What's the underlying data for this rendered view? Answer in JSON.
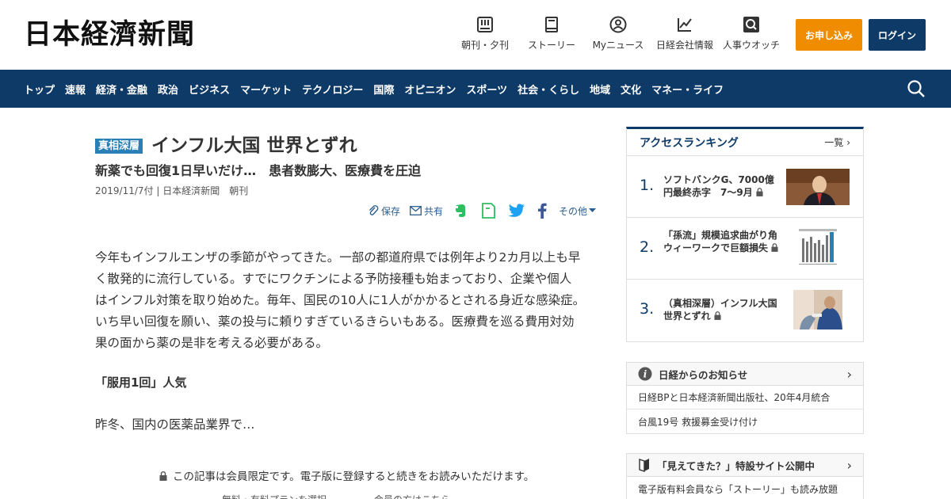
{
  "header": {
    "logo": "日本経濟新聞",
    "nav": [
      {
        "label": "朝刊・夕刊",
        "icon": "newspaper-icon"
      },
      {
        "label": "ストーリー",
        "icon": "book-icon"
      },
      {
        "label": "Myニュース",
        "icon": "user-icon"
      },
      {
        "label": "日経会社情報",
        "icon": "chart-icon"
      },
      {
        "label": "人事ウオッチ",
        "icon": "search-person-icon"
      }
    ],
    "apply_label": "お申し込み",
    "login_label": "ログイン"
  },
  "main_nav": [
    "トップ",
    "速報",
    "経済・金融",
    "政治",
    "ビジネス",
    "マーケット",
    "テクノロジー",
    "国際",
    "オピニオン",
    "スポーツ",
    "社会・くらし",
    "地域",
    "文化",
    "マネー・ライフ"
  ],
  "article": {
    "tag": "真相深層",
    "title": "インフル大国 世界とずれ",
    "subtitle": "新薬でも回復1日早いだけ…　患者数膨大、医療費を圧迫",
    "dateline": "2019/11/7付 | 日本経済新聞　朝刊",
    "share": {
      "save": "保存",
      "share": "共有",
      "more": "その他"
    },
    "body_lines": [
      "今年もインフルエンザの季節がやってきた。一部の都道府県では例年より2カ月以上も早",
      "く散発的に流行している。すでにワクチンによる予防接種も始まっており、企業や個人",
      "はインフル対策を取り始めた。毎年、国民の10人に1人がかかるとされる身近な感染症。",
      "いち早い回復を願い、薬の投与に頼りすぎているきらいもある。医療費を巡る費用対効",
      "果の面から薬の是非を考える必要がある。"
    ],
    "section_heading": "「服用1回」人気",
    "continuation": "昨冬、国内の医薬品業界で…",
    "paywall_text": "この記事は会員限定です。電子版に登録すると続きをお読みいただけます。",
    "paywall_links": "無料・有料プランを選択　　　　　会員の方はこちら"
  },
  "ranking": {
    "title": "アクセスランキング",
    "more": "一覧",
    "items": [
      {
        "rank": "1.",
        "text": "ソフトバンクG、7000億円最終赤字　7～9月"
      },
      {
        "rank": "2.",
        "text": "「孫流」規模追求曲がり角　ウィーワークで巨額損失"
      },
      {
        "rank": "3.",
        "text": "（真相深層）インフル大国 世界とずれ"
      }
    ]
  },
  "notice": {
    "title": "日経からのお知らせ",
    "items": [
      "日経BPと日本経済新聞出版社、20年4月統合",
      "台風19号 救援募金受け付け"
    ]
  },
  "feature": {
    "title": "「見えてきた？」特設サイト公開中",
    "items": [
      "電子版有料会員なら「ストーリー」も読み放題"
    ]
  },
  "colors": {
    "navy": "#0e3a68",
    "orange": "#f08c00",
    "tag_blue": "#2a7fb5",
    "evernote_green": "#2dbe60",
    "twitter_blue": "#1da1f2",
    "facebook_blue": "#3b5998"
  }
}
